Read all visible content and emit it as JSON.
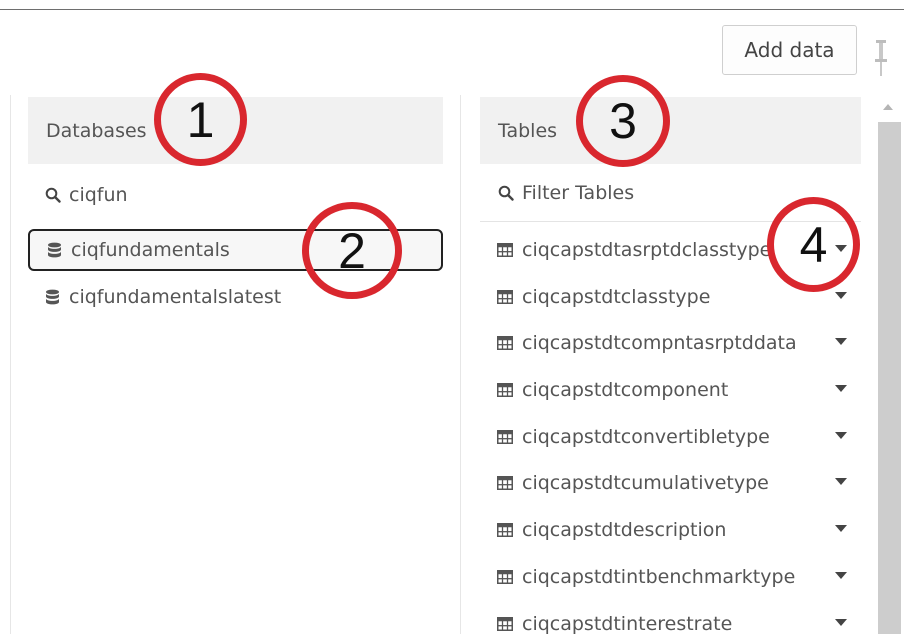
{
  "toolbar": {
    "add_data_label": "Add data"
  },
  "databases": {
    "header": "Databases",
    "search_value": "ciqfun",
    "items": [
      {
        "label": "ciqfundamentals",
        "selected": true
      },
      {
        "label": "ciqfundamentalslatest",
        "selected": false
      }
    ]
  },
  "tables": {
    "header": "Tables",
    "filter_placeholder": "Filter Tables",
    "items": [
      "ciqcapstdtasrptdclasstype",
      "ciqcapstdtclasstype",
      "ciqcapstdtcompntasrptddata",
      "ciqcapstdtcomponent",
      "ciqcapstdtconvertibletype",
      "ciqcapstdtcumulativetype",
      "ciqcapstdtdescription",
      "ciqcapstdtintbenchmarktype",
      "ciqcapstdtinterestrate"
    ]
  },
  "annotations": [
    "1",
    "2",
    "3",
    "4"
  ],
  "colors": {
    "annotation": "#d9272e",
    "selected_border": "#222222",
    "header_bg": "#f1f1f1"
  },
  "icons": {
    "search": "search-icon",
    "database": "database-icon",
    "table": "table-grid-icon",
    "dropdown": "caret-down-icon",
    "pin": "pin-icon"
  }
}
